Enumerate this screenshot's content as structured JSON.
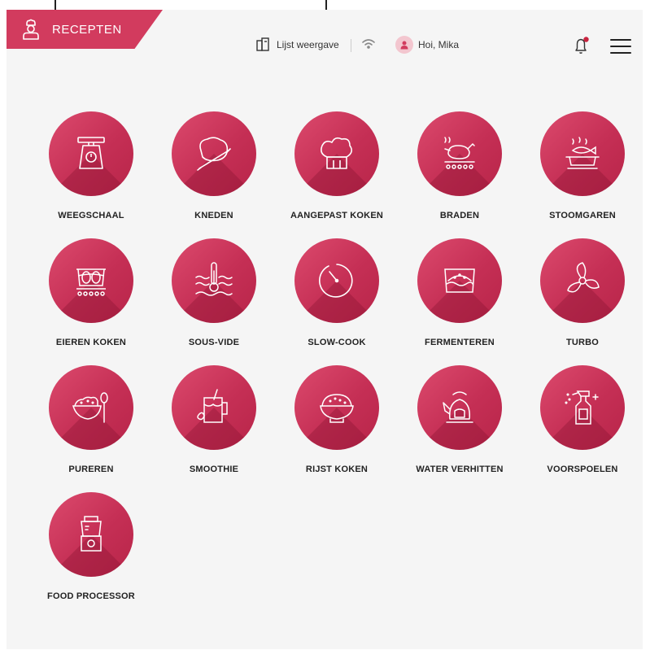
{
  "header": {
    "recepten_label": "RECEPTEN",
    "list_view_label": "Lijst weergave",
    "greeting": "Hoi, Mika",
    "notification_dot_color": "#c8243f"
  },
  "accent_color": "#d23b5e",
  "programs": [
    {
      "label": "WEEGSCHAAL",
      "icon": "scale-icon"
    },
    {
      "label": "KNEDEN",
      "icon": "dough-rolling-pin-icon"
    },
    {
      "label": "AANGEPAST KOKEN",
      "icon": "chef-hat-icon"
    },
    {
      "label": "BRADEN",
      "icon": "roast-chicken-icon"
    },
    {
      "label": "STOOMGAREN",
      "icon": "steam-fish-icon"
    },
    {
      "label": "EIEREN KOKEN",
      "icon": "eggs-pot-icon"
    },
    {
      "label": "SOUS-VIDE",
      "icon": "thermometer-water-icon"
    },
    {
      "label": "SLOW-COOK",
      "icon": "timer-icon"
    },
    {
      "label": "FERMENTEREN",
      "icon": "fermenting-bowl-icon"
    },
    {
      "label": "TURBO",
      "icon": "turbo-blade-icon"
    },
    {
      "label": "PUREREN",
      "icon": "puree-bowl-icon"
    },
    {
      "label": "SMOOTHIE",
      "icon": "smoothie-jar-icon"
    },
    {
      "label": "RIJST KOKEN",
      "icon": "rice-bowl-icon"
    },
    {
      "label": "WATER VERHITTEN",
      "icon": "kettle-icon"
    },
    {
      "label": "VOORSPOELEN",
      "icon": "spray-bottle-icon"
    },
    {
      "label": "FOOD PROCESSOR",
      "icon": "food-processor-icon"
    }
  ]
}
